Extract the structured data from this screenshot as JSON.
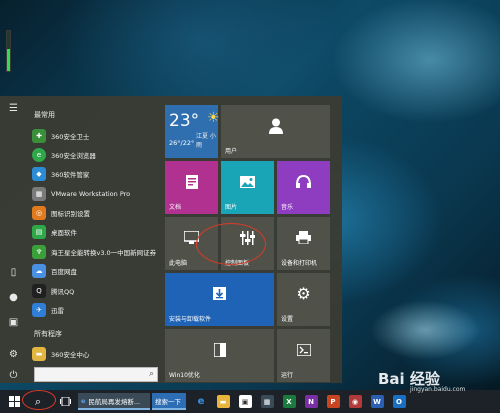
{
  "start_menu": {
    "most_used_header": "最常用",
    "all_apps_header": "所有程序",
    "most_used": [
      {
        "label": "360安全卫士",
        "icon": "shield-icon",
        "color": "#3a8f3a"
      },
      {
        "label": "360安全浏览器",
        "icon": "browser-icon",
        "color": "#2fa84a"
      },
      {
        "label": "360软件管家",
        "icon": "software-icon",
        "color": "#2b8bd4"
      },
      {
        "label": "VMware Workstation Pro",
        "icon": "vmware-icon",
        "color": "#7a7a7a"
      },
      {
        "label": "图标识别设置",
        "icon": "settings-icon",
        "color": "#e07a1f"
      },
      {
        "label": "桌面软件",
        "icon": "desktop-icon",
        "color": "#2fa84a"
      },
      {
        "label": "海王星全能转换v3.0一中国新网证券",
        "icon": "neptune-icon",
        "color": "#3aa03a"
      },
      {
        "label": "百度网盘",
        "icon": "cloud-icon",
        "color": "#4a90e2"
      },
      {
        "label": "腾讯QQ",
        "icon": "qq-icon",
        "color": "#202020"
      },
      {
        "label": "迅雷",
        "icon": "thunder-icon",
        "color": "#2f7fd8"
      }
    ],
    "all_apps": [
      {
        "label": "360安全中心",
        "icon": "folder-icon",
        "color": "#e3b640"
      }
    ]
  },
  "tiles": {
    "weather": {
      "temp": "23°",
      "city": "江夏 小雨",
      "range": "26°/22°",
      "bg": "#2f6fb0"
    },
    "user": {
      "label": "用户",
      "bg": "#50524a"
    },
    "documents": {
      "label": "文档",
      "bg": "#b0318f"
    },
    "pictures": {
      "label": "图片",
      "bg": "#19a5b6"
    },
    "music": {
      "label": "音乐",
      "bg": "#8e3cc0"
    },
    "this_pc": {
      "label": "此电脑",
      "bg": "#50524a"
    },
    "control_panel": {
      "label": "控制面板",
      "bg": "#50524a"
    },
    "devices": {
      "label": "设备和打印机",
      "bg": "#50524a"
    },
    "install": {
      "label": "安装与卸载软件",
      "bg": "#1e63b5"
    },
    "settings": {
      "label": "设置",
      "bg": "#50524a"
    },
    "win10": {
      "label": "Win10优化",
      "bg": "#50524a"
    },
    "run": {
      "label": "运行",
      "bg": "#50524a"
    }
  },
  "taskbar": {
    "browser_task": "民航局再发熔断...",
    "search_task": "搜索一下",
    "apps": [
      "edge-icon",
      "file-explorer-icon",
      "store-icon",
      "excel-icon",
      "onenote-icon",
      "powerpoint-icon",
      "word-icon",
      "outlook-icon"
    ]
  },
  "watermark": {
    "text": "Bai 经验",
    "url": "jingyan.baidu.com"
  },
  "accent": "#7fb3e0"
}
